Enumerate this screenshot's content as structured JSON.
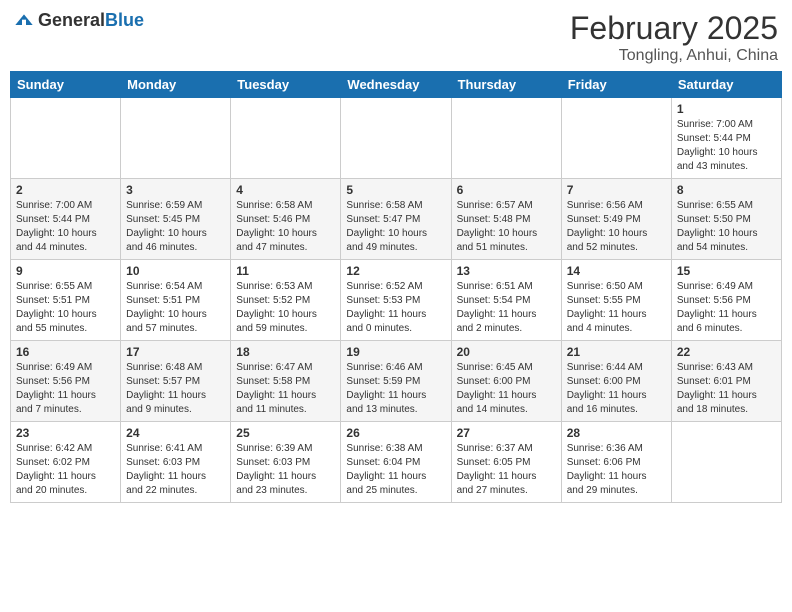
{
  "header": {
    "logo_general": "General",
    "logo_blue": "Blue",
    "month": "February 2025",
    "location": "Tongling, Anhui, China"
  },
  "weekdays": [
    "Sunday",
    "Monday",
    "Tuesday",
    "Wednesday",
    "Thursday",
    "Friday",
    "Saturday"
  ],
  "weeks": [
    [
      {
        "day": "",
        "info": ""
      },
      {
        "day": "",
        "info": ""
      },
      {
        "day": "",
        "info": ""
      },
      {
        "day": "",
        "info": ""
      },
      {
        "day": "",
        "info": ""
      },
      {
        "day": "",
        "info": ""
      },
      {
        "day": "1",
        "info": "Sunrise: 7:00 AM\nSunset: 5:44 PM\nDaylight: 10 hours and 43 minutes."
      }
    ],
    [
      {
        "day": "2",
        "info": "Sunrise: 7:00 AM\nSunset: 5:44 PM\nDaylight: 10 hours and 44 minutes."
      },
      {
        "day": "3",
        "info": "Sunrise: 6:59 AM\nSunset: 5:45 PM\nDaylight: 10 hours and 46 minutes."
      },
      {
        "day": "4",
        "info": "Sunrise: 6:58 AM\nSunset: 5:46 PM\nDaylight: 10 hours and 47 minutes."
      },
      {
        "day": "5",
        "info": "Sunrise: 6:58 AM\nSunset: 5:47 PM\nDaylight: 10 hours and 49 minutes."
      },
      {
        "day": "6",
        "info": "Sunrise: 6:57 AM\nSunset: 5:48 PM\nDaylight: 10 hours and 51 minutes."
      },
      {
        "day": "7",
        "info": "Sunrise: 6:56 AM\nSunset: 5:49 PM\nDaylight: 10 hours and 52 minutes."
      },
      {
        "day": "8",
        "info": "Sunrise: 6:55 AM\nSunset: 5:50 PM\nDaylight: 10 hours and 54 minutes."
      }
    ],
    [
      {
        "day": "9",
        "info": "Sunrise: 6:55 AM\nSunset: 5:51 PM\nDaylight: 10 hours and 55 minutes."
      },
      {
        "day": "10",
        "info": "Sunrise: 6:54 AM\nSunset: 5:51 PM\nDaylight: 10 hours and 57 minutes."
      },
      {
        "day": "11",
        "info": "Sunrise: 6:53 AM\nSunset: 5:52 PM\nDaylight: 10 hours and 59 minutes."
      },
      {
        "day": "12",
        "info": "Sunrise: 6:52 AM\nSunset: 5:53 PM\nDaylight: 11 hours and 0 minutes."
      },
      {
        "day": "13",
        "info": "Sunrise: 6:51 AM\nSunset: 5:54 PM\nDaylight: 11 hours and 2 minutes."
      },
      {
        "day": "14",
        "info": "Sunrise: 6:50 AM\nSunset: 5:55 PM\nDaylight: 11 hours and 4 minutes."
      },
      {
        "day": "15",
        "info": "Sunrise: 6:49 AM\nSunset: 5:56 PM\nDaylight: 11 hours and 6 minutes."
      }
    ],
    [
      {
        "day": "16",
        "info": "Sunrise: 6:49 AM\nSunset: 5:56 PM\nDaylight: 11 hours and 7 minutes."
      },
      {
        "day": "17",
        "info": "Sunrise: 6:48 AM\nSunset: 5:57 PM\nDaylight: 11 hours and 9 minutes."
      },
      {
        "day": "18",
        "info": "Sunrise: 6:47 AM\nSunset: 5:58 PM\nDaylight: 11 hours and 11 minutes."
      },
      {
        "day": "19",
        "info": "Sunrise: 6:46 AM\nSunset: 5:59 PM\nDaylight: 11 hours and 13 minutes."
      },
      {
        "day": "20",
        "info": "Sunrise: 6:45 AM\nSunset: 6:00 PM\nDaylight: 11 hours and 14 minutes."
      },
      {
        "day": "21",
        "info": "Sunrise: 6:44 AM\nSunset: 6:00 PM\nDaylight: 11 hours and 16 minutes."
      },
      {
        "day": "22",
        "info": "Sunrise: 6:43 AM\nSunset: 6:01 PM\nDaylight: 11 hours and 18 minutes."
      }
    ],
    [
      {
        "day": "23",
        "info": "Sunrise: 6:42 AM\nSunset: 6:02 PM\nDaylight: 11 hours and 20 minutes."
      },
      {
        "day": "24",
        "info": "Sunrise: 6:41 AM\nSunset: 6:03 PM\nDaylight: 11 hours and 22 minutes."
      },
      {
        "day": "25",
        "info": "Sunrise: 6:39 AM\nSunset: 6:03 PM\nDaylight: 11 hours and 23 minutes."
      },
      {
        "day": "26",
        "info": "Sunrise: 6:38 AM\nSunset: 6:04 PM\nDaylight: 11 hours and 25 minutes."
      },
      {
        "day": "27",
        "info": "Sunrise: 6:37 AM\nSunset: 6:05 PM\nDaylight: 11 hours and 27 minutes."
      },
      {
        "day": "28",
        "info": "Sunrise: 6:36 AM\nSunset: 6:06 PM\nDaylight: 11 hours and 29 minutes."
      },
      {
        "day": "",
        "info": ""
      }
    ]
  ]
}
